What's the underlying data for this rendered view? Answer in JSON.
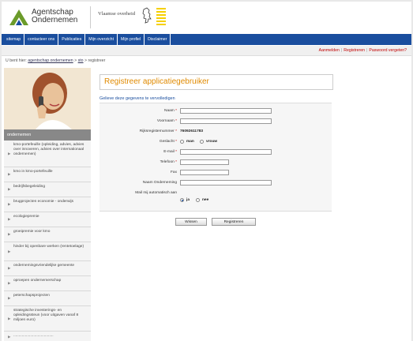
{
  "header": {
    "logo_line1": "Agentschap",
    "logo_line2": "Ondernemen",
    "government_text": "Vlaamse overheid",
    "logo_icon": "agentschap-logo-mark",
    "lion_icon": "flemish-lion-icon"
  },
  "topnav": {
    "items": [
      "sitemap",
      "contacteer ons",
      "Publicaties",
      "Mijn overzicht",
      "Mijn profiel",
      "Disclaimer"
    ]
  },
  "account": {
    "login": "Aanmelden",
    "register": "Registreren",
    "forgot": "Paswoord vergeten?"
  },
  "breadcrumb": {
    "prefix": "U bent hier:",
    "crumb1": "agentschap ondernemen",
    "crumb2": "sto",
    "current": "registreer"
  },
  "sidebar": {
    "heading": "ondernemen",
    "items": [
      "kmo-portefeuille (opleiding, advies, advies over innoveren, advies over internationaal ondernemen)",
      "kmo in kmo-portefeuille",
      "bedrijfsbegeleiding",
      "brugprojecten economie - onderwijs",
      "ecologiepremie",
      "groeipremie voor kmo",
      "hinder bij openbare werken (rentetoelage)",
      "ondernemingsvriendelijke gemeente",
      "oproepen ondernemerschap",
      "peterschapsprojecten",
      "strategische investerings- en opleidingssteun (voor uitgaven vanaf 8 miljoen euro)",
      "......................................"
    ]
  },
  "form": {
    "title": "Registreer applicatiegebruiker",
    "intro": "Gelieve deze gegevens te vervolledigen",
    "fields": {
      "naam": "Naam",
      "voornaam": "Voornaam",
      "rijksregister_label": "Rijksregisternummer",
      "rijksregister_value": "76092611783",
      "geslacht": "Geslacht",
      "man": "man",
      "vrouw": "vrouw",
      "email": "E-mail",
      "telefoon": "Telefoon",
      "fax": "Fax",
      "onderneming": "Naam Onderneming",
      "mail_auto": "Mail mij automatisch aan",
      "ja": "ja",
      "nee": "nee"
    },
    "required_mark": "*",
    "buttons": {
      "clear": "Wissen",
      "submit": "Registreren"
    },
    "gender_selected": "none",
    "mail_selected": "ja"
  },
  "colors": {
    "nav": "#1a4e9e",
    "accent_red": "#c00000",
    "title_orange": "#e08a00",
    "logo_green": "#6b9b2a"
  }
}
